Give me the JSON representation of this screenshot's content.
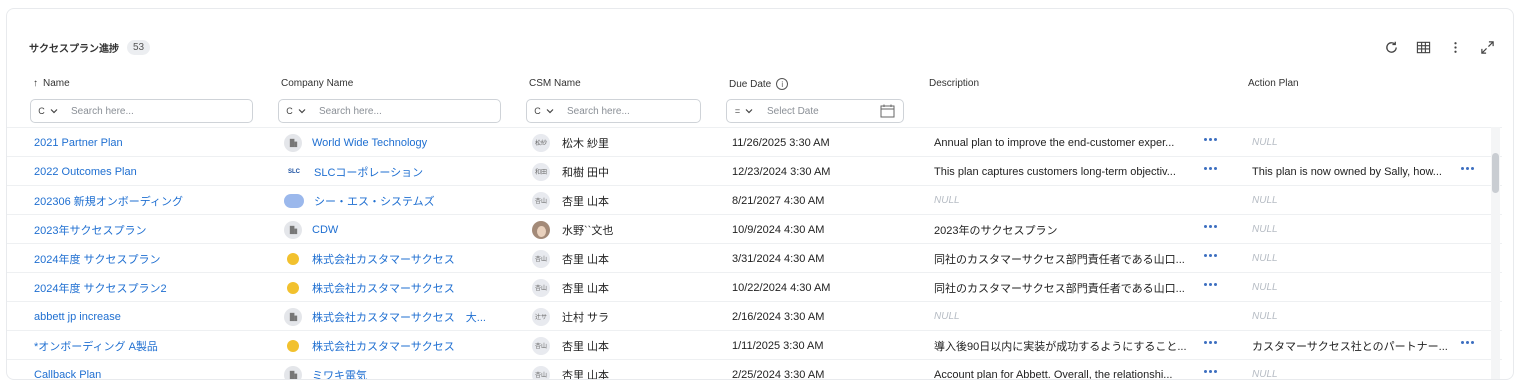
{
  "header": {
    "title": "サクセスプラン進捗",
    "count": "53"
  },
  "toolbar": [
    "refresh-icon",
    "table-columns-icon",
    "more-vertical-icon",
    "expand-icon"
  ],
  "columns": {
    "name": "Name",
    "company": "Company Name",
    "csm": "CSM Name",
    "due": "Due Date",
    "description": "Description",
    "action": "Action Plan"
  },
  "filters": {
    "name": {
      "op": "C",
      "placeholder": "Search here..."
    },
    "company": {
      "op": "C",
      "placeholder": "Search here..."
    },
    "csm": {
      "op": "C",
      "placeholder": "Search here..."
    },
    "due": {
      "op": "=",
      "placeholder": "Select Date"
    }
  },
  "sort": {
    "column": "Name",
    "direction": "ascending"
  },
  "rows": [
    {
      "name": "2021 Partner Plan",
      "company": "World Wide Technology",
      "company_logo": "building-icon",
      "csm_initials": "松紗",
      "csm": "松木 紗里",
      "due": "11/26/2025 3:30 AM",
      "description": "Annual plan to improve the end-customer exper...",
      "description_more": true,
      "action": "NULL",
      "action_null": true,
      "action_more": false
    },
    {
      "name": "2022 Outcomes Plan",
      "company": "SLCコーポレーション",
      "company_logo": "slc-logo",
      "csm_initials": "和田",
      "csm": "和樹 田中",
      "due": "12/23/2024 3:30 AM",
      "description": "This plan captures customers long-term objectiv...",
      "description_more": true,
      "action": "This plan is now owned by Sally, how...",
      "action_null": false,
      "action_more": true
    },
    {
      "name": "202306 新規オンボーディング",
      "company": "シー・エス・システムズ",
      "company_logo": "blob-logo",
      "csm_initials": "杏山",
      "csm": "杏里 山本",
      "due": "8/21/2027 4:30 AM",
      "description": "NULL",
      "description_null": true,
      "description_more": false,
      "action": "NULL",
      "action_null": true,
      "action_more": false
    },
    {
      "name": "2023年サクセスプラン",
      "company": "CDW",
      "company_logo": "building-icon",
      "csm_initials": "",
      "csm_photo": true,
      "csm": "水野``文也",
      "due": "10/9/2024 4:30 AM",
      "description": "2023年のサクセスプラン",
      "description_more": true,
      "action": "NULL",
      "action_null": true,
      "action_more": false
    },
    {
      "name": "2024年度 サクセスプラン",
      "company": "株式会社カスタマーサクセス",
      "company_logo": "sun-logo",
      "csm_initials": "杏山",
      "csm": "杏里 山本",
      "due": "3/31/2024 4:30 AM",
      "description": "同社のカスタマーサクセス部門責任者である山口...",
      "description_more": true,
      "action": "NULL",
      "action_null": true,
      "action_more": false
    },
    {
      "name": "2024年度 サクセスプラン2",
      "company": "株式会社カスタマーサクセス",
      "company_logo": "sun-logo",
      "csm_initials": "杏山",
      "csm": "杏里 山本",
      "due": "10/22/2024 4:30 AM",
      "description": "同社のカスタマーサクセス部門責任者である山口...",
      "description_more": true,
      "action": "NULL",
      "action_null": true,
      "action_more": false
    },
    {
      "name": "abbett jp increase",
      "company": "株式会社カスタマーサクセス　大...",
      "company_logo": "building-icon",
      "csm_initials": "辻サ",
      "csm": "辻村 サラ",
      "due": "2/16/2024 3:30 AM",
      "description": "NULL",
      "description_null": true,
      "description_more": false,
      "action": "NULL",
      "action_null": true,
      "action_more": false
    },
    {
      "name": "*オンボーディング A製品",
      "company": "株式会社カスタマーサクセス",
      "company_logo": "sun-logo",
      "csm_initials": "杏山",
      "csm": "杏里 山本",
      "due": "1/11/2025 3:30 AM",
      "description": "導入後90日以内に実装が成功するようにすること...",
      "description_more": true,
      "action": "カスタマーサクセス社とのパートナー...",
      "action_null": false,
      "action_more": true
    },
    {
      "name": "Callback Plan",
      "company": "ミワキ電気",
      "company_logo": "building-icon",
      "csm_initials": "杏山",
      "csm": "杏里 山本",
      "due": "2/25/2024 3:30 AM",
      "description": "Account plan for Abbett. Overall, the relationshi...",
      "description_more": true,
      "action": "NULL",
      "action_null": true,
      "action_more": false
    }
  ]
}
